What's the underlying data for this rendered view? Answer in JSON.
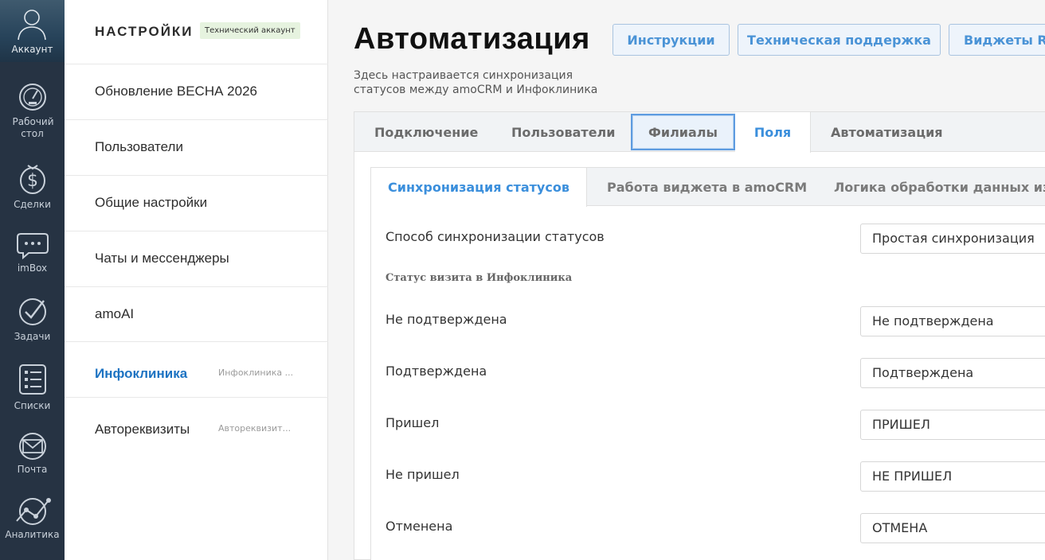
{
  "nav": {
    "account_label": "Аккаунт",
    "items": [
      {
        "label": "Рабочий стол",
        "icon": "dashboard-icon"
      },
      {
        "label": "Сделки",
        "icon": "dollar-icon"
      },
      {
        "label": "imBox",
        "icon": "chat-icon"
      },
      {
        "label": "Задачи",
        "icon": "check-icon"
      },
      {
        "label": "Списки",
        "icon": "list-icon"
      },
      {
        "label": "Почта",
        "icon": "mail-icon"
      },
      {
        "label": "Аналитика",
        "icon": "analytics-icon"
      }
    ]
  },
  "sidebar": {
    "title": "НАСТРОЙКИ",
    "badge": "Технический аккаунт",
    "items": [
      {
        "label": "Обновление ВЕСНА 2026",
        "sub": ""
      },
      {
        "label": "Пользователи",
        "sub": ""
      },
      {
        "label": "Общие настройки",
        "sub": ""
      },
      {
        "label": "Чаты и мессенджеры",
        "sub": ""
      },
      {
        "label": "amoAI",
        "sub": ""
      },
      {
        "label": "Инфоклиника",
        "sub": "Инфоклиника ..."
      },
      {
        "label": "Автореквизиты",
        "sub": "Автореквизит..."
      }
    ]
  },
  "header": {
    "title": "Автоматизация",
    "subtitle": "Здесь настраивается синхронизация статусов между amoCRM и Инфоклиника",
    "buttons": [
      "Инструкции",
      "Техническая поддержка",
      "Виджеты Ru"
    ]
  },
  "tabs": [
    "Подключение",
    "Пользователи",
    "Филиалы",
    "Поля",
    "Автоматизация"
  ],
  "subtabs": [
    "Синхронизация статусов",
    "Работа виджета в amoCRM",
    "Логика обработки данных из И"
  ],
  "form": {
    "sync_method_label": "Способ синхронизации статусов",
    "sync_method_value": "Простая синхронизация",
    "section_caption": "Статус визита в Инфоклиника",
    "rows": [
      {
        "label": "Не подтверждена",
        "value": "Не подтверждена"
      },
      {
        "label": "Подтверждена",
        "value": "Подтверждена"
      },
      {
        "label": "Пришел",
        "value": "ПРИШЕЛ"
      },
      {
        "label": "Не пришел",
        "value": "НЕ ПРИШЕЛ"
      },
      {
        "label": "Отменена",
        "value": "ОТМЕНА"
      }
    ]
  },
  "colors": {
    "nav_bg": "#263343",
    "accent": "#3b8fdc",
    "badge_bg": "#e6f3df"
  }
}
